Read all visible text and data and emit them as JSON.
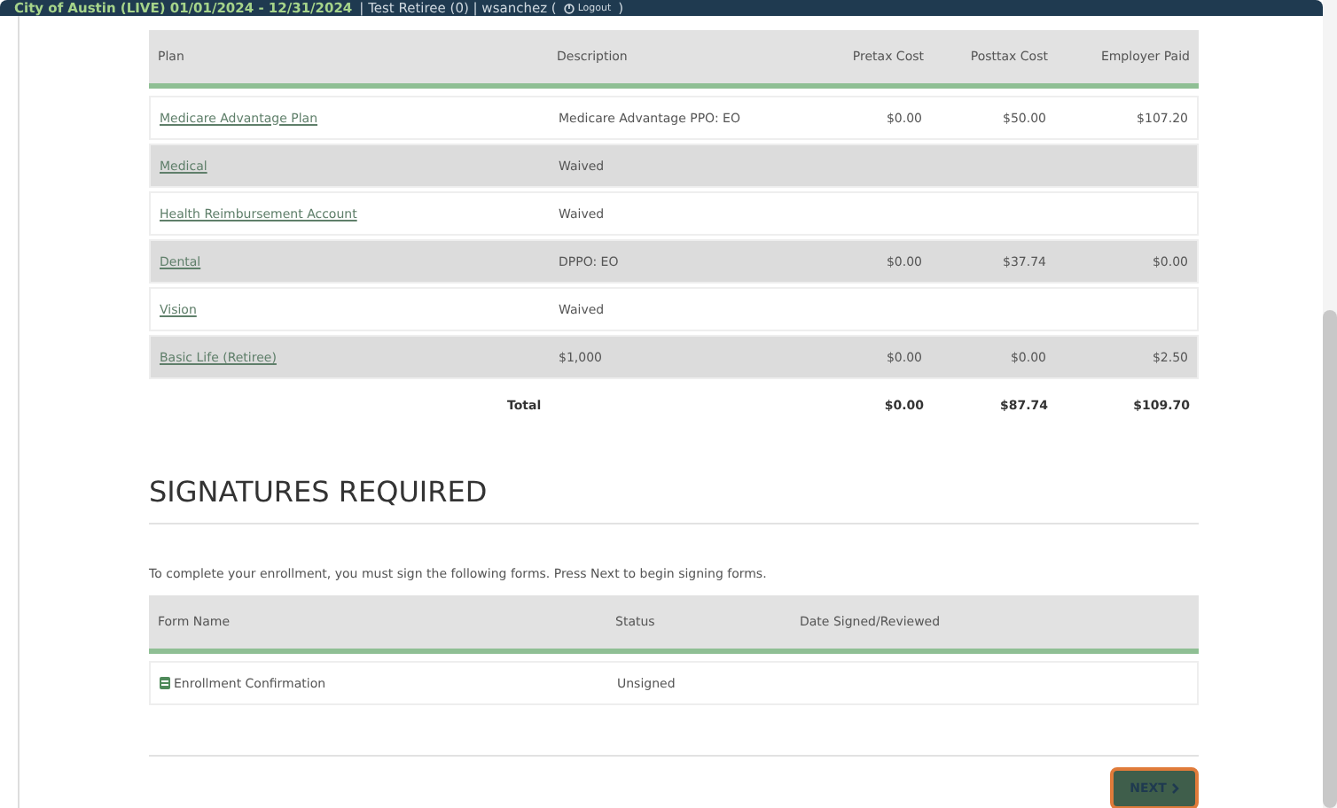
{
  "top_bar": {
    "title": "City of Austin (LIVE) 01/01/2024 - 12/31/2024",
    "user": "| Test Retiree (0) | wsanchez (",
    "logout": "Logout",
    "close": ")"
  },
  "plans_table": {
    "columns": [
      "Plan",
      "Description",
      "Pretax Cost",
      "Posttax Cost",
      "Employer Paid"
    ],
    "rows": [
      {
        "plan": "Medicare Advantage Plan",
        "description": "Medicare Advantage PPO: EO",
        "pretax": "$0.00",
        "posttax": "$50.00",
        "employer": "$107.20"
      },
      {
        "plan": "Medical",
        "description": "Waived"
      },
      {
        "plan": "Health Reimbursement Account",
        "description": "Waived"
      },
      {
        "plan": "Dental",
        "description": "DPPO: EO",
        "pretax": "$0.00",
        "posttax": "$37.74",
        "employer": "$0.00"
      },
      {
        "plan": "Vision",
        "description": "Waived"
      },
      {
        "plan": "Basic Life (Retiree)",
        "description": "$1,000",
        "pretax": "$0.00",
        "posttax": "$0.00",
        "employer": "$2.50"
      }
    ],
    "total": {
      "label": "Total",
      "pretax": "$0.00",
      "posttax": "$87.74",
      "employer": "$109.70"
    }
  },
  "signatures": {
    "heading": "SIGNATURES REQUIRED",
    "instructions": "To complete your enrollment, you must sign the following forms. Press Next to begin signing forms.",
    "columns": [
      "Form Name",
      "Status",
      "Date Signed/Reviewed"
    ],
    "rows": [
      {
        "form": "Enrollment Confirmation",
        "status": "Unsigned"
      }
    ],
    "next_button": "NEXT"
  }
}
